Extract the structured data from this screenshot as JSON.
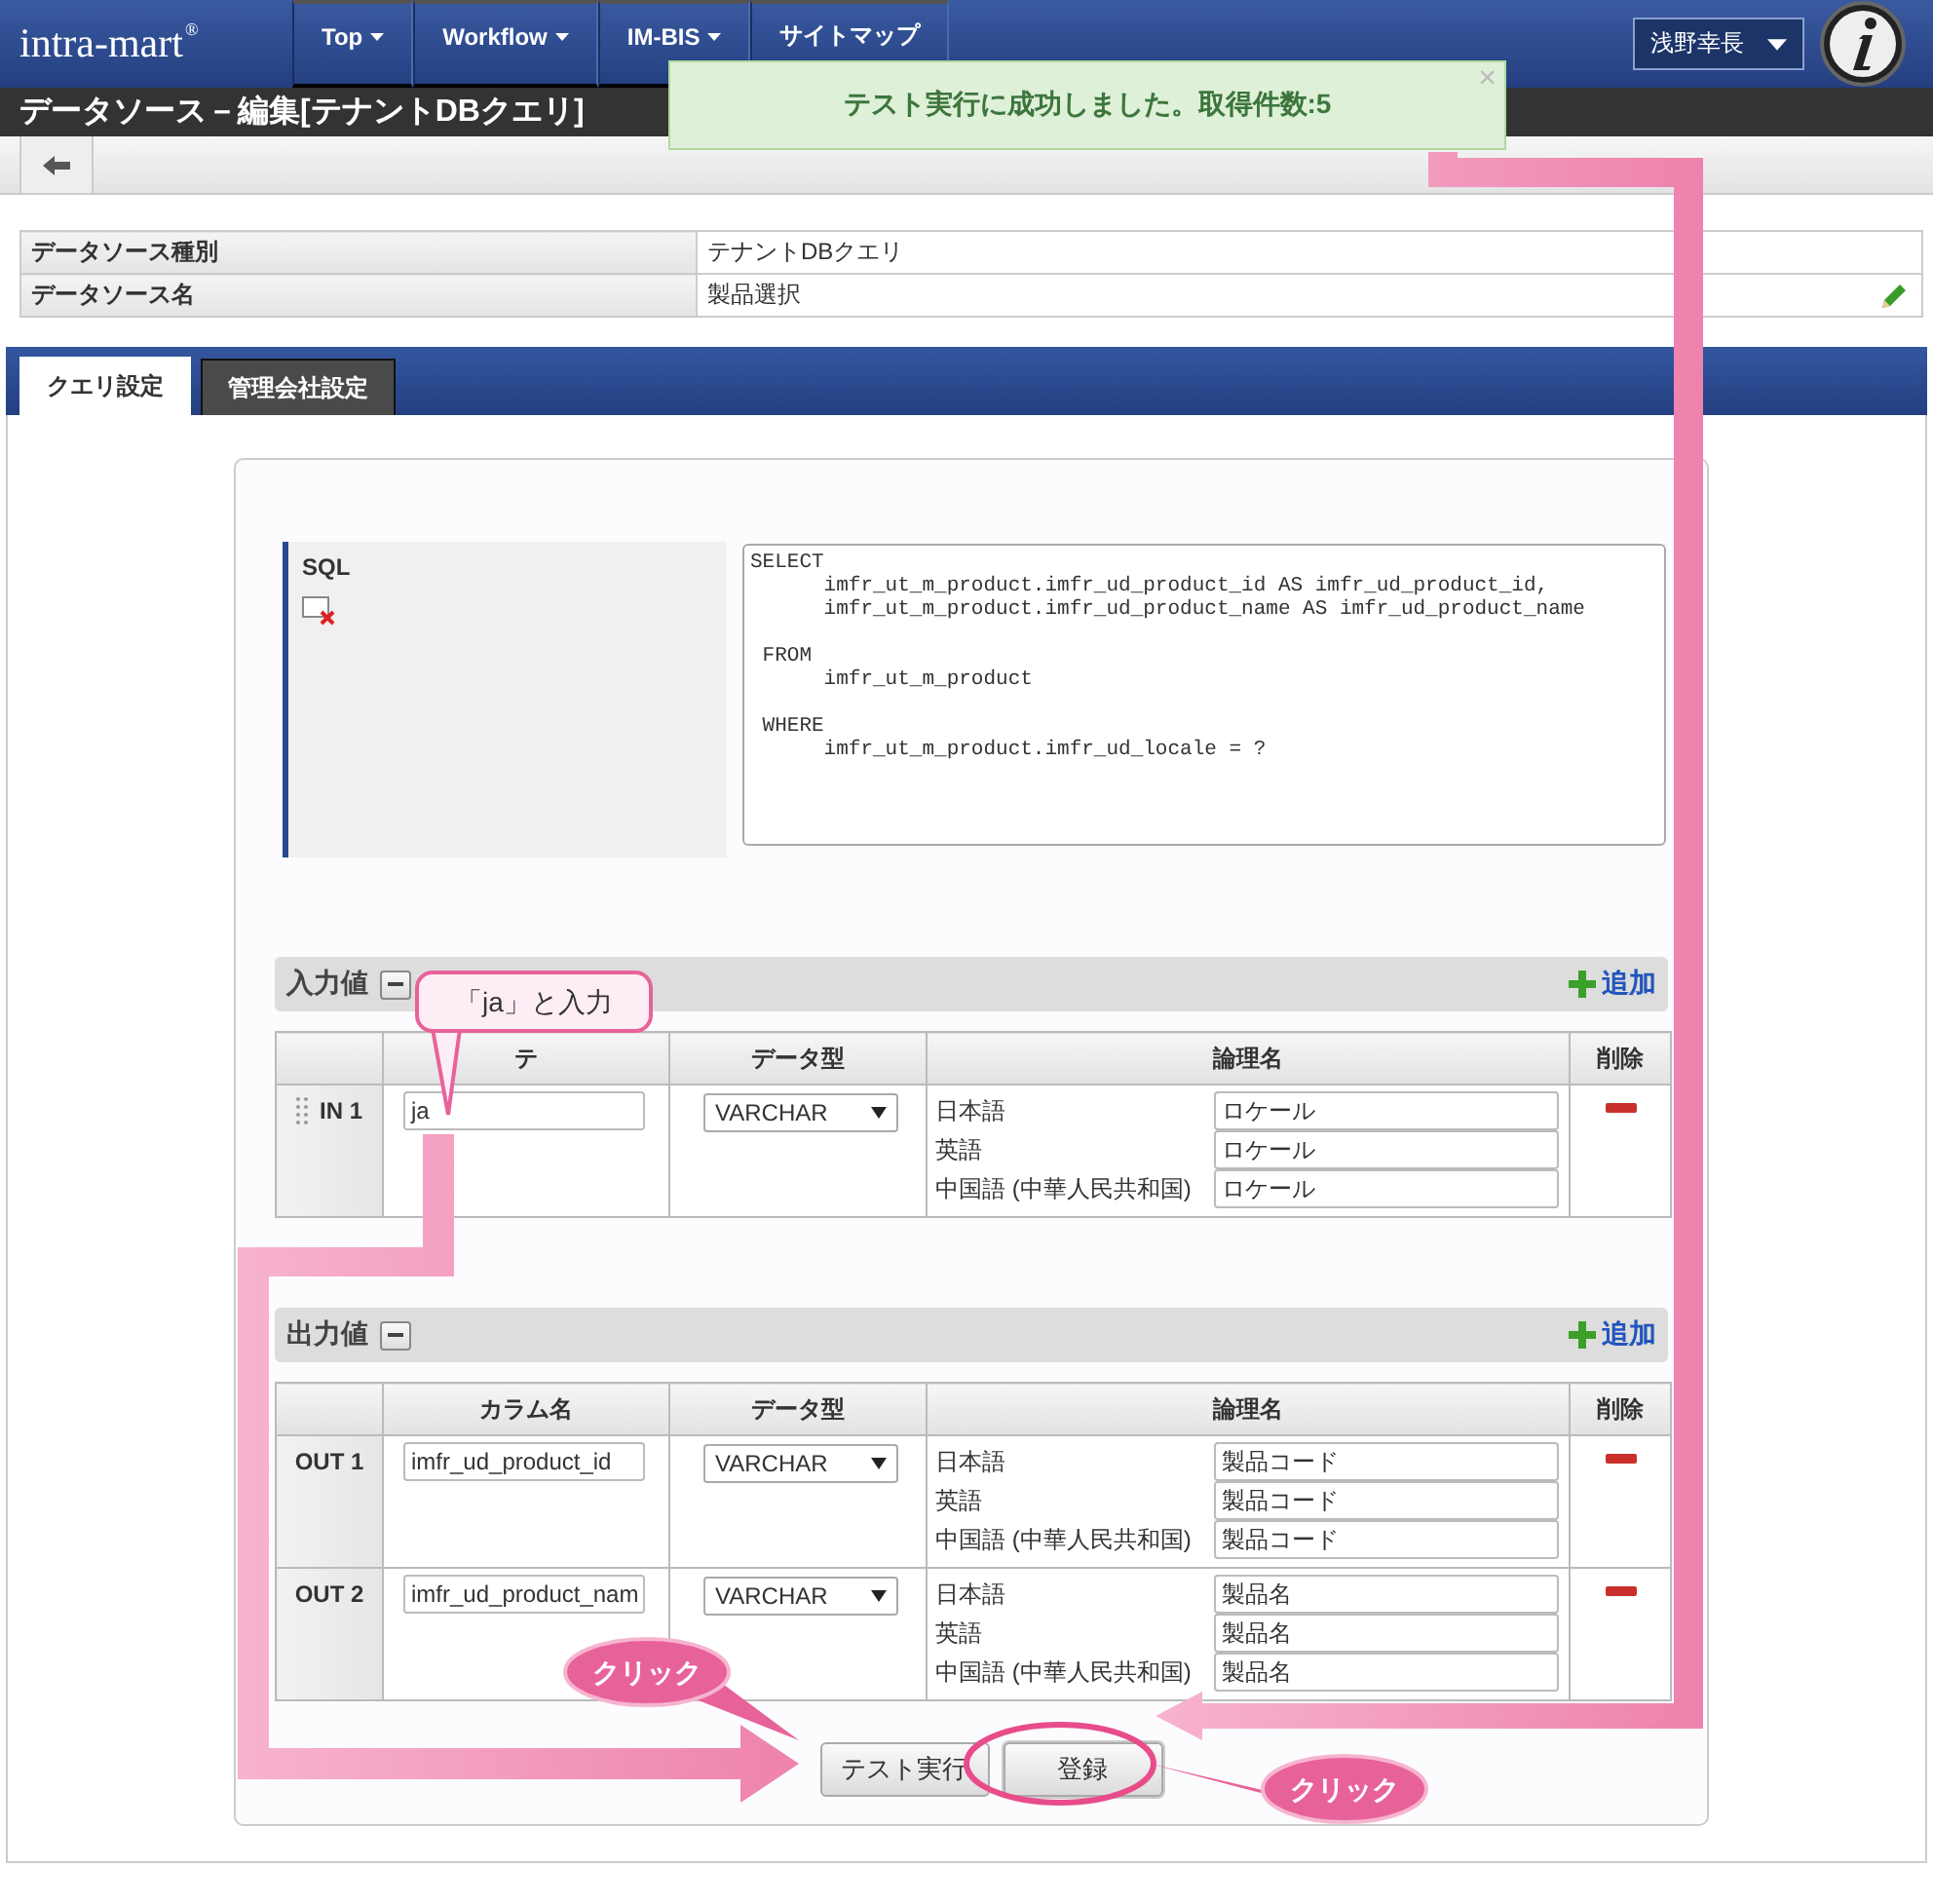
{
  "header": {
    "logo": "intra-mart",
    "logo_mark": "®",
    "nav": [
      {
        "label": "Top",
        "dropdown": true
      },
      {
        "label": "Workflow",
        "dropdown": true
      },
      {
        "label": "IM-BIS",
        "dropdown": true
      },
      {
        "label": "サイトマップ",
        "dropdown": false
      }
    ],
    "user": "浅野幸長"
  },
  "toast": {
    "message": "テスト実行に成功しました。取得件数:5",
    "close": "×"
  },
  "page_title": "データソース－編集[テナントDBクエリ]",
  "info": [
    {
      "label": "データソース種別",
      "value": "テナントDBクエリ",
      "editable": false
    },
    {
      "label": "データソース名",
      "value": "製品選択",
      "editable": true
    }
  ],
  "tabs": [
    {
      "label": "クエリ設定",
      "selected": true
    },
    {
      "label": "管理会社設定",
      "selected": false
    }
  ],
  "sql": {
    "label": "SQL",
    "text": "SELECT\n      imfr_ut_m_product.imfr_ud_product_id AS imfr_ud_product_id,\n      imfr_ut_m_product.imfr_ud_product_name AS imfr_ud_product_name\n\n FROM\n      imfr_ut_m_product\n\n WHERE\n      imfr_ut_m_product.imfr_ud_locale = ?"
  },
  "sections": [
    {
      "title": "入力値",
      "add": "追加",
      "columns": [
        "",
        "テ",
        "データ型",
        "論理名",
        "削除"
      ],
      "draggable": true,
      "rows": [
        {
          "name": "IN 1",
          "value": "ja",
          "type": "VARCHAR",
          "names": [
            {
              "lang": "日本語",
              "value": "ロケール"
            },
            {
              "lang": "英語",
              "value": "ロケール"
            },
            {
              "lang": "中国語 (中華人民共和国)",
              "value": "ロケール"
            }
          ]
        }
      ]
    },
    {
      "title": "出力値",
      "add": "追加",
      "columns": [
        "",
        "カラム名",
        "データ型",
        "論理名",
        "削除"
      ],
      "draggable": false,
      "rows": [
        {
          "name": "OUT 1",
          "value": "imfr_ud_product_id",
          "type": "VARCHAR",
          "names": [
            {
              "lang": "日本語",
              "value": "製品コード"
            },
            {
              "lang": "英語",
              "value": "製品コード"
            },
            {
              "lang": "中国語 (中華人民共和国)",
              "value": "製品コード"
            }
          ]
        },
        {
          "name": "OUT 2",
          "value": "imfr_ud_product_nam",
          "type": "VARCHAR",
          "names": [
            {
              "lang": "日本語",
              "value": "製品名"
            },
            {
              "lang": "英語",
              "value": "製品名"
            },
            {
              "lang": "中国語 (中華人民共和国)",
              "value": "製品名"
            }
          ]
        }
      ]
    }
  ],
  "buttons": [
    {
      "label": "テスト実行",
      "highlighted": false
    },
    {
      "label": "登録",
      "highlighted": true
    }
  ],
  "annotations": [
    {
      "kind": "callout",
      "text": "「ja」と入力"
    },
    {
      "kind": "click",
      "text": "クリック"
    },
    {
      "kind": "click",
      "text": "クリック"
    }
  ]
}
